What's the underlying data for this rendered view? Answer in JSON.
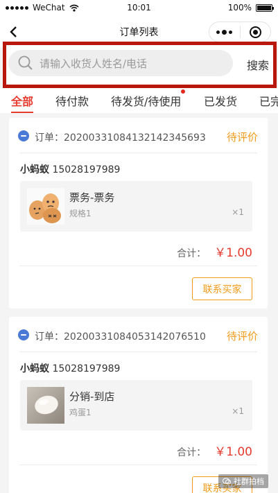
{
  "status_bar": {
    "carrier": "WeChat",
    "time": "10:01",
    "battery": "100%"
  },
  "nav": {
    "title": "订单列表"
  },
  "search": {
    "placeholder": "请输入收货人姓名/电话",
    "button_label": "搜索"
  },
  "tabs": [
    {
      "label": "全部",
      "active": true
    },
    {
      "label": "待付款",
      "active": false
    },
    {
      "label": "待发货/待使用",
      "active": false,
      "has_dot": true
    },
    {
      "label": "已发货",
      "active": false
    },
    {
      "label": "已完",
      "active": false
    }
  ],
  "orders": [
    {
      "order_label": "订单：",
      "order_no": "20200331084132142345693",
      "status": "待评价",
      "buyer_name": "小蚂蚁",
      "buyer_phone": "15028197989",
      "product_name": "票务-票务",
      "spec": "规格1",
      "qty": "×1",
      "total_label": "合计：",
      "total": "￥1.00",
      "action": "联系买家"
    },
    {
      "order_label": "订单：",
      "order_no": "20200331084053142076510",
      "status": "待评价",
      "buyer_name": "小蚂蚁",
      "buyer_phone": "15028197989",
      "product_name": "分销-到店",
      "spec": "鸡蛋1",
      "qty": "×1",
      "total_label": "合计：",
      "total": "￥1.00",
      "action": "联系买家"
    }
  ],
  "colors": {
    "accent_red": "#e63a2e",
    "status_orange": "#f29b1a",
    "highlight_border": "#b8170c",
    "order_icon_blue": "#4a7ad6"
  },
  "icons": [
    "signal-dots-icon",
    "wifi-icon",
    "battery-icon",
    "back-arrow-icon",
    "more-dots-icon",
    "target-icon",
    "search-icon",
    "order-icon",
    "wechat-icon"
  ],
  "watermark": {
    "text": "社群拍档"
  }
}
